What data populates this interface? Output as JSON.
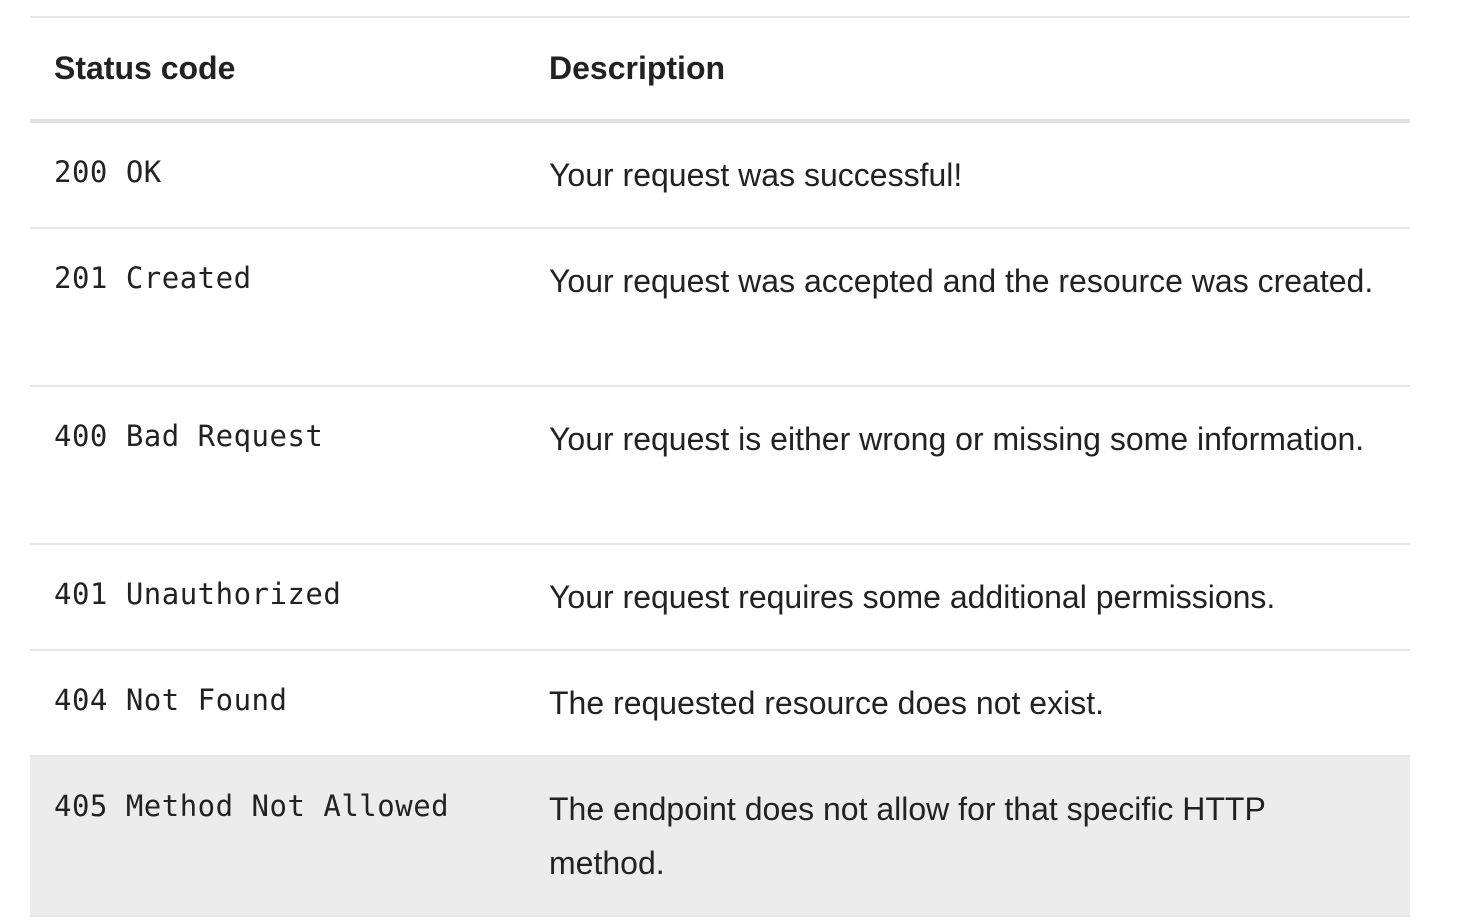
{
  "table": {
    "headers": {
      "status_code": "Status code",
      "description": "Description"
    },
    "rows": [
      {
        "code": "200 OK",
        "description": "Your request was successful!"
      },
      {
        "code": "201 Created",
        "description": "Your request was accepted and the resource was created."
      },
      {
        "code": "400 Bad Request",
        "description": "Your request is either wrong or missing some information."
      },
      {
        "code": "401 Unauthorized",
        "description": "Your request requires some additional permissions."
      },
      {
        "code": "404 Not Found",
        "description": "The requested resource does not exist."
      },
      {
        "code": "405 Method Not Allowed",
        "description": "The endpoint does not allow for that specific HTTP method."
      }
    ]
  },
  "colors": {
    "text": "#222222",
    "row_highlight": "#ececec",
    "border": "#e6e6e6"
  }
}
